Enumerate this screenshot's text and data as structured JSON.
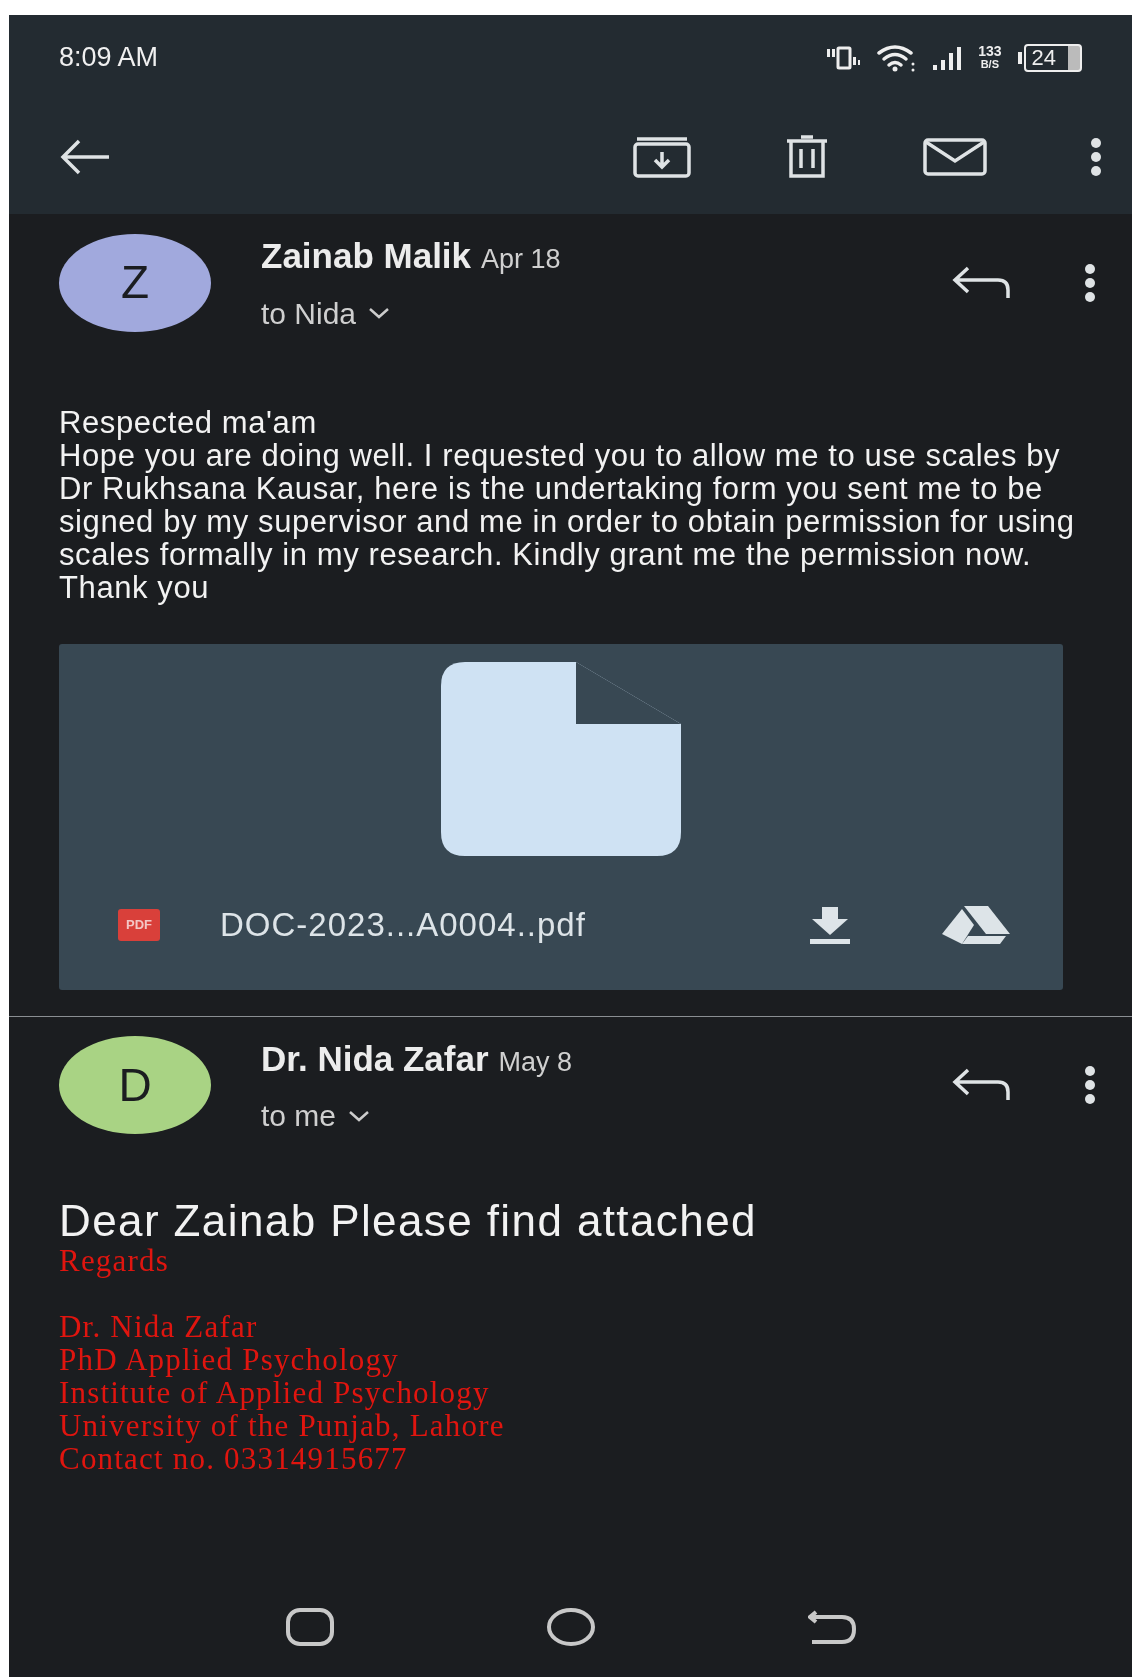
{
  "status_bar": {
    "time": "8:09 AM",
    "speed_value": "133",
    "speed_unit": "B/S",
    "battery": "24"
  },
  "messages": [
    {
      "sender": "Zainab Malik",
      "date": "Apr 18",
      "recipient": "to Nida",
      "avatar_letter": "Z",
      "color": "#a1a9dd",
      "body": [
        "Respected ma'am",
        "Hope you are doing well. I requested you to allow me to use scales by Dr Rukhsana Kausar, here is the undertaking form you sent me to be signed by my supervisor and me in order to obtain permission for using scales formally in my research. Kindly grant me the permission now.",
        "Thank you"
      ],
      "attachments": [
        {
          "type_label": "PDF",
          "file_name": "DOC-2023...A0004..pdf"
        }
      ]
    },
    {
      "sender": "Dr. Nida Zafar",
      "date": "May 8",
      "recipient": "to me",
      "avatar_letter": "D",
      "color": "#a9d384",
      "greeting": "Dear Zainab Please find attached",
      "signature": {
        "closing": "Regards",
        "lines": [
          "Dr. Nida Zafar",
          "PhD Applied Psychology",
          "Institute of Applied Psychology",
          "University of the Punjab, Lahore",
          "Contact no. 03314915677"
        ]
      }
    }
  ]
}
